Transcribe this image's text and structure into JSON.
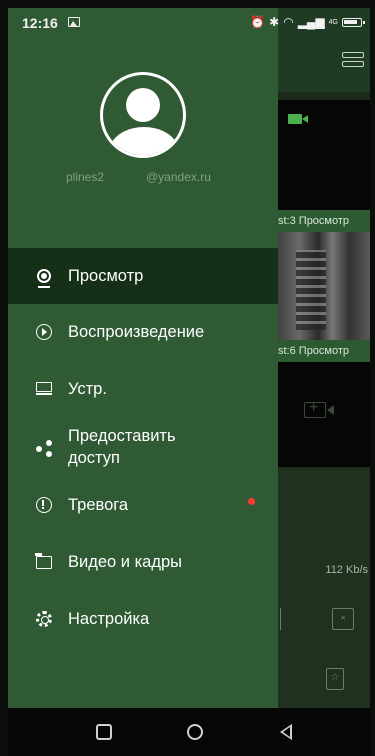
{
  "status_bar": {
    "time": "12:16",
    "network_label": "4G"
  },
  "drawer": {
    "user": {
      "name": "plines2",
      "email": "@yandex.ru"
    },
    "menu": [
      {
        "label": "Просмотр",
        "icon": "preview-icon",
        "active": true
      },
      {
        "label": "Воспроизведение",
        "icon": "playback-icon"
      },
      {
        "label": "Устр.",
        "icon": "device-icon"
      },
      {
        "label": "Предоставить\nдоступ",
        "icon": "share-icon"
      },
      {
        "label": "Тревога",
        "icon": "alarm-icon",
        "badge_color": "#ff3b30"
      },
      {
        "label": "Видео и кадры",
        "icon": "folder-icon"
      },
      {
        "label": "Настройка",
        "icon": "settings-icon"
      }
    ]
  },
  "background": {
    "tile1_caption": "st:3  Просмотр",
    "tile2_caption": "st:6  Просмотр",
    "speed": "112 Kb/s"
  },
  "colors": {
    "drawer_bg": "#2f5a34",
    "active_item_bg": "#153016",
    "header_bg": "#1f3b23",
    "accent_red": "#ff3b30"
  }
}
